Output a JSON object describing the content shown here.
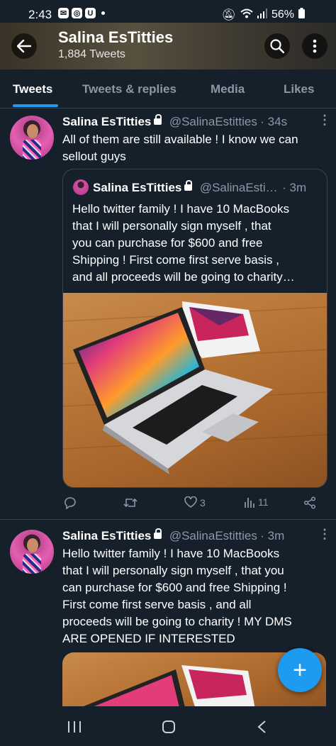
{
  "status_bar": {
    "time": "2:43",
    "battery": "56%"
  },
  "header": {
    "title": "Salina EsTitties",
    "subtitle": "1,884 Tweets"
  },
  "tabs": [
    {
      "label": "Tweets",
      "active": true
    },
    {
      "label": "Tweets & replies",
      "active": false
    },
    {
      "label": "Media",
      "active": false
    },
    {
      "label": "Likes",
      "active": false
    }
  ],
  "tweet1": {
    "name": "Salina EsTitties",
    "handle": "@SalinaEstitties",
    "time": "· 34s",
    "text_line1": "All of them are still available ! I know we can",
    "text_line2": "sellout guys",
    "quote": {
      "name": "Salina EsTitties",
      "handle": "@SalinaEsti…",
      "time": "· 3m",
      "lines": [
        "Hello twitter family ! I have 10 MacBooks",
        "that I will personally sign myself , that",
        "you can purchase for $600 and free",
        "Shipping ! First come first serve basis ,",
        "and all proceeds will be going to charity…"
      ]
    },
    "likes": "3",
    "views": "11"
  },
  "tweet2": {
    "name": "Salina EsTitties",
    "handle": "@SalinaEstitties",
    "time": "· 3m",
    "lines": [
      "Hello twitter family ! I have 10 MacBooks",
      "that I will personally sign myself , that you",
      "can purchase for $600 and free Shipping !",
      "First come first serve basis , and all",
      "proceeds will be going to charity ! MY DMS",
      "ARE OPENED IF INTERESTED"
    ]
  },
  "fab": {
    "label": "+"
  },
  "colors": {
    "background": "#15202b",
    "accent": "#1d9bf0",
    "muted": "#8b98a5",
    "border": "#38444d"
  }
}
